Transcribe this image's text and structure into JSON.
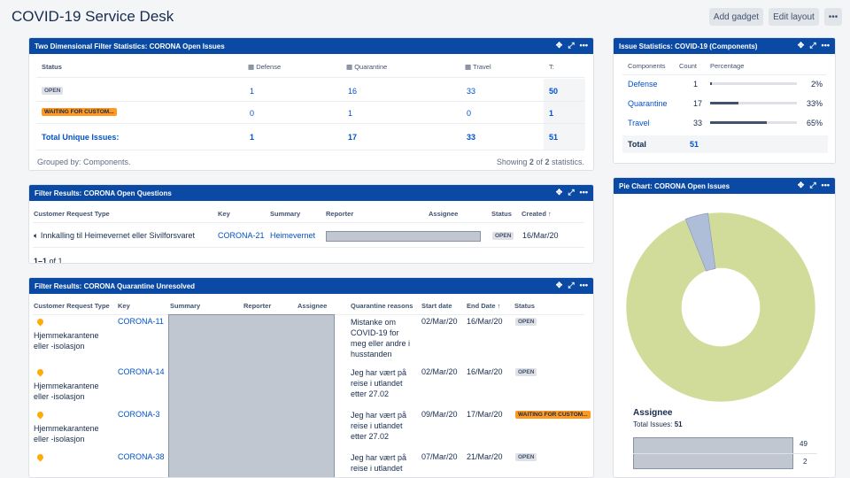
{
  "header": {
    "title": "COVID-19 Service Desk",
    "add_gadget": "Add gadget",
    "edit_layout": "Edit layout",
    "more": "•••"
  },
  "icons": {
    "move": "move-icon",
    "expand": "expand-icon",
    "more": "more-icon"
  },
  "two_dim": {
    "title": "Two Dimensional Filter Statistics: CORONA Open Issues",
    "cols": [
      "Status",
      "Defense",
      "Quarantine",
      "Travel",
      "T:"
    ],
    "rows": [
      {
        "status": "OPEN",
        "values": [
          "1",
          "16",
          "33",
          "50"
        ]
      },
      {
        "status": "WAITING FOR CUSTOM...",
        "values": [
          "0",
          "1",
          "0",
          "1"
        ]
      }
    ],
    "total_label": "Total Unique Issues:",
    "totals": [
      "1",
      "17",
      "33",
      "51"
    ],
    "grouped_by": "Grouped by: Components.",
    "showing_pre": "Showing",
    "showing_a": "2",
    "showing_mid": "of",
    "showing_b": "2",
    "showing_post": "statistics."
  },
  "issue_stats": {
    "title": "Issue Statistics: COVID-19 (Components)",
    "headers": [
      "Components",
      "Count",
      "Percentage"
    ],
    "rows": [
      {
        "name": "Defense",
        "count": "1",
        "pct": "2%",
        "fraction": 0.02
      },
      {
        "name": "Quarantine",
        "count": "17",
        "pct": "33%",
        "fraction": 0.33
      },
      {
        "name": "Travel",
        "count": "33",
        "pct": "65%",
        "fraction": 0.65
      }
    ],
    "total_label": "Total",
    "total": "51"
  },
  "open_questions": {
    "title": "Filter Results: CORONA Open Questions",
    "headers": [
      "Customer Request Type",
      "Key",
      "Summary",
      "Reporter",
      "Assignee",
      "Status",
      "Created"
    ],
    "row": {
      "type": "Innkalling til Heimevernet eller Sivilforsvaret",
      "key": "CORONA-21",
      "summary": "Heimevernet",
      "status": "OPEN",
      "created": "16/Mar/20"
    },
    "paging_bold": "1–1",
    "paging_rest": "of 1"
  },
  "quarantine": {
    "title": "Filter Results: CORONA Quarantine Unresolved",
    "headers": [
      "Customer Request Type",
      "Key",
      "Summary",
      "Reporter",
      "Assignee",
      "Quarantine reasons",
      "Start date",
      "End Date",
      "Status"
    ],
    "rows": [
      {
        "type": "Hjemmekarantene eller -isolasjon",
        "key": "CORONA-11",
        "reason": "Mistanke om COVID-19 for meg eller andre i husstanden",
        "start": "02/Mar/20",
        "end": "16/Mar/20",
        "status": "OPEN"
      },
      {
        "type": "Hjemmekarantene eller -isolasjon",
        "key": "CORONA-14",
        "reason": "Jeg har vært på reise i utlandet etter 27.02",
        "start": "02/Mar/20",
        "end": "16/Mar/20",
        "status": "OPEN"
      },
      {
        "type": "Hjemmekarantene eller -isolasjon",
        "key": "CORONA-3",
        "reason": "Jeg har vært på reise i utlandet etter 27.02",
        "start": "09/Mar/20",
        "end": "17/Mar/20",
        "status": "WAITING FOR CUSTOM..."
      },
      {
        "type": "",
        "key": "CORONA-38",
        "reason": "Jeg har vært på reise i utlandet",
        "start": "07/Mar/20",
        "end": "21/Mar/20",
        "status": "OPEN"
      }
    ]
  },
  "pie": {
    "title": "Pie Chart: CORONA Open Issues",
    "legend_title": "Assignee",
    "total_label": "Total Issues:",
    "total": "51",
    "legend_values": [
      "49",
      "2"
    ]
  },
  "chart_data": {
    "type": "pie",
    "values": [
      49,
      2
    ],
    "colors": [
      "#d1dc9a",
      "#aebed9"
    ]
  }
}
